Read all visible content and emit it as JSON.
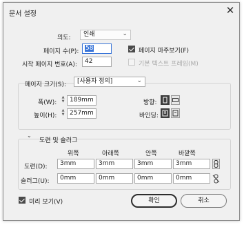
{
  "window": {
    "title": "문서 설정",
    "close_glyph": "✕"
  },
  "intent": {
    "label": "의도:",
    "value": "인쇄"
  },
  "pages": {
    "label": "페이지 수(P):",
    "value": "58"
  },
  "facing": {
    "label": "페이지 마주보기(F)",
    "checked": true
  },
  "start_page": {
    "label": "시작 페이지 번호(A):",
    "value": "42"
  },
  "primary_frame": {
    "label": "기본 텍스트 프레임(M)",
    "checked": false,
    "disabled": true
  },
  "page_size": {
    "label": "페이지 크기(S):",
    "value": "[사용자 정의]",
    "width_label": "폭(W):",
    "width_value": "189mm",
    "height_label": "높이(H):",
    "height_value": "257mm",
    "orientation_label": "방향:",
    "binding_label": "바인딩:"
  },
  "margins": {
    "section_label": "도련 및 슬러그",
    "columns": [
      "위쪽",
      "아래쪽",
      "안쪽",
      "바깥쪽"
    ],
    "bleed_label": "도련(D):",
    "bleed_values": [
      "3mm",
      "3mm",
      "3mm",
      "3mm"
    ],
    "slug_label": "슬러그(U):",
    "slug_values": [
      "0mm",
      "0mm",
      "0mm",
      "0mm"
    ]
  },
  "preview": {
    "label": "미리 보기(V)",
    "checked": true
  },
  "buttons": {
    "ok": "확인",
    "cancel": "취소"
  },
  "icons": {
    "close": "close-icon",
    "dropdown": "chevron-down-icon",
    "orientation_portrait": "portrait-orientation-icon",
    "orientation_landscape": "landscape-orientation-icon",
    "binding_ltr": "left-to-right-binding-icon",
    "binding_rtl": "right-to-left-binding-icon",
    "link_bleed": "chain-link-icon",
    "link_slug": "broken-chain-link-icon"
  },
  "colors": {
    "accent": "#3874d8",
    "background": "#f0f0f0"
  }
}
